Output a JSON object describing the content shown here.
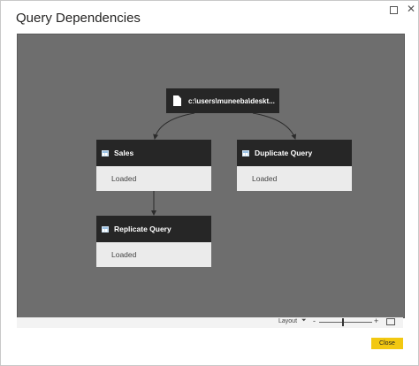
{
  "dialog": {
    "title": "Query Dependencies"
  },
  "graph": {
    "source": {
      "label": "c:\\users\\muneeba\\deskt..."
    },
    "nodes": [
      {
        "name": "Sales",
        "status": "Loaded"
      },
      {
        "name": "Duplicate Query",
        "status": "Loaded"
      },
      {
        "name": "Replicate Query",
        "status": "Loaded"
      }
    ]
  },
  "statusbar": {
    "layout_label": "Layout",
    "zoom_minus": "-",
    "zoom_plus": "+"
  },
  "footer": {
    "close_label": "Close"
  },
  "colors": {
    "accent": "#f2c811",
    "canvas": "#6e6e6e",
    "node_header": "#262626",
    "node_body": "#ebebeb"
  }
}
